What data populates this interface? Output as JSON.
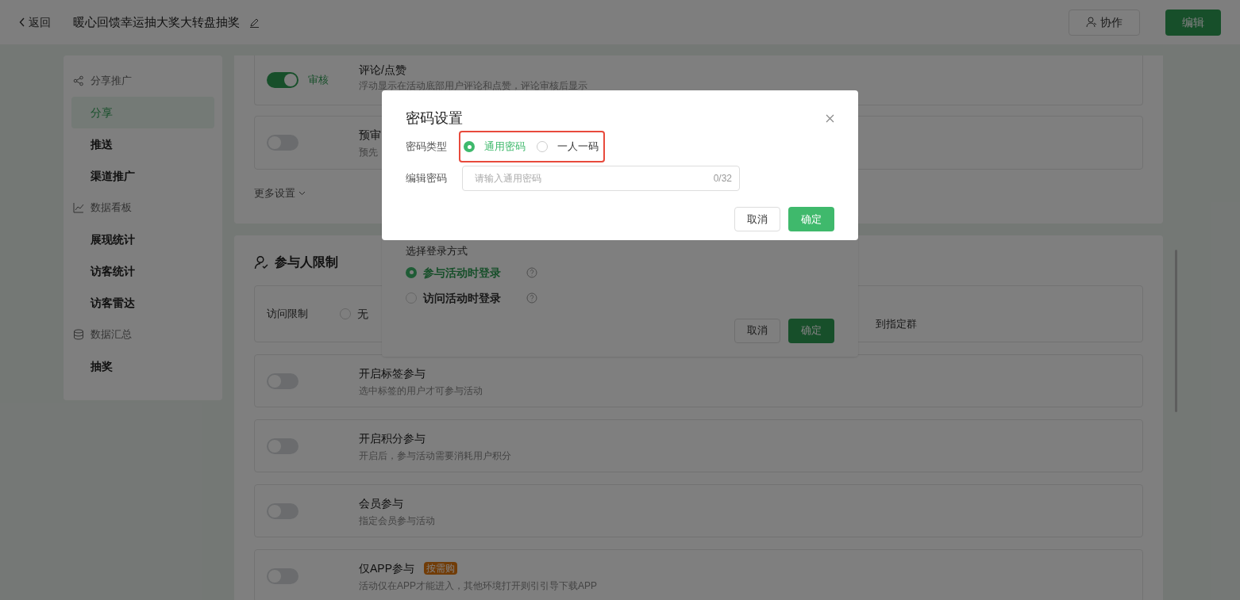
{
  "header": {
    "back": "返回",
    "title": "暖心回馈幸运抽大奖大转盘抽奖",
    "collaborate": "协作",
    "edit": "编辑"
  },
  "sidebar": [
    {
      "label": "分享推广",
      "children": [
        {
          "label": "分享",
          "selected": true
        },
        {
          "label": "推送",
          "selected": false
        },
        {
          "label": "渠道推广",
          "selected": false
        }
      ]
    },
    {
      "label": "数据看板",
      "children": [
        {
          "label": "展现统计",
          "selected": false
        },
        {
          "label": "访客统计",
          "selected": false
        },
        {
          "label": "访客雷达",
          "selected": false
        }
      ]
    },
    {
      "label": "数据汇总",
      "children": [
        {
          "label": "抽奖",
          "selected": false
        }
      ]
    }
  ],
  "settings_rows": [
    {
      "on": true,
      "toggle_label": "审核",
      "title": "评论/点赞",
      "description": "浮动显示在活动底部用户评论和点赞，评论审核后显示"
    },
    {
      "on": false,
      "title": "预审",
      "description": "预先"
    }
  ],
  "more_settings": "更多设置",
  "participant_section": {
    "title": "参与人限制",
    "access": {
      "label": "访问限制",
      "options": [
        {
          "label": "无",
          "selected": false
        }
      ],
      "trailing_text": "到指定群"
    },
    "rows": [
      {
        "on": false,
        "title": "开启标签参与",
        "description": "选中标签的用户才可参与活动"
      },
      {
        "on": false,
        "title": "开启积分参与",
        "description": "开启后，参与活动需要消耗用户积分"
      },
      {
        "on": false,
        "title": "会员参与",
        "description": "指定会员参与活动"
      },
      {
        "on": false,
        "title": "仅APP参与",
        "badge": "按需购",
        "description": "活动仅在APP才能进入，其他环境打开则引引导下载APP"
      }
    ]
  },
  "login_dialog": {
    "title": "选择登录方式",
    "options": [
      {
        "label": "参与活动时登录",
        "selected": true
      },
      {
        "label": "访问活动时登录",
        "selected": false
      }
    ],
    "cancel": "取消",
    "confirm": "确定"
  },
  "password_dialog": {
    "title": "密码设置",
    "type_label": "密码类型",
    "types": [
      {
        "label": "通用密码",
        "selected": true
      },
      {
        "label": "一人一码",
        "selected": false
      }
    ],
    "edit_label": "编辑密码",
    "placeholder": "请输入通用密码",
    "counter": "0/32",
    "cancel": "取消",
    "confirm": "确定"
  }
}
